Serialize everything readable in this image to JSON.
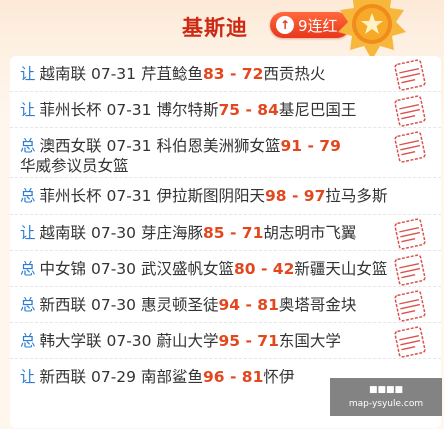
{
  "header": {
    "title": "基斯迪",
    "streak_label": "9连红",
    "streak_icon": "up-arrow-icon"
  },
  "colors": {
    "title": "#cc2a14",
    "streak_bg": "#e8361c",
    "type_link": "#2a7cd6",
    "score": "#e3471e",
    "stamp": "#d9534f"
  },
  "matches": [
    {
      "type": "让",
      "league": "越南联",
      "date": "07-31",
      "home": "芹苴鲶鱼",
      "home_score": "83",
      "sep": " - ",
      "away_score": "72",
      "away": "西贡热火",
      "stamp": true
    },
    {
      "type": "让",
      "league": "菲州长杯",
      "date": "07-31",
      "home": "博尔特斯",
      "home_score": "75",
      "sep": " - ",
      "away_score": "84",
      "away": "基尼巴国王",
      "stamp": true
    },
    {
      "type": "总",
      "league": "澳西女联",
      "date": "07-31",
      "home": "科伯恩美洲狮女篮",
      "home_score": "91",
      "sep": " - ",
      "away_score": "79",
      "away": "华威参议员女篮",
      "stamp": true
    },
    {
      "type": "总",
      "league": "菲州长杯",
      "date": "07-31",
      "home": "伊拉斯图阴阳天",
      "home_score": "98",
      "sep": " - ",
      "away_score": "97",
      "away": "拉马多斯",
      "stamp": false
    },
    {
      "type": "让",
      "league": "越南联",
      "date": "07-30",
      "home": "芽庄海豚",
      "home_score": "85",
      "sep": " - ",
      "away_score": "71",
      "away": "胡志明市飞翼",
      "stamp": true
    },
    {
      "type": "总",
      "league": "中女锦",
      "date": "07-30",
      "home": "武汉盛帆女篮",
      "home_score": "80",
      "sep": " - ",
      "away_score": "42",
      "away": "新疆天山女篮",
      "stamp": true
    },
    {
      "type": "总",
      "league": "新西联",
      "date": "07-30",
      "home": "惠灵顿圣徒",
      "home_score": "94",
      "sep": " - ",
      "away_score": "81",
      "away": "奥塔哥金块",
      "stamp": true
    },
    {
      "type": "总",
      "league": "韩大学联",
      "date": "07-30",
      "home": "蔚山大学",
      "home_score": "95",
      "sep": " - ",
      "away_score": "71",
      "away": "东国大学",
      "stamp": true
    },
    {
      "type": "让",
      "league": "新西联",
      "date": "07-29",
      "home": "南部鲨鱼",
      "home_score": "96",
      "sep": " - ",
      "away_score": "81",
      "away": "怀伊",
      "stamp": false
    }
  ],
  "watermark": {
    "line1": "■■■■",
    "line2": "map-ysyule.com"
  }
}
